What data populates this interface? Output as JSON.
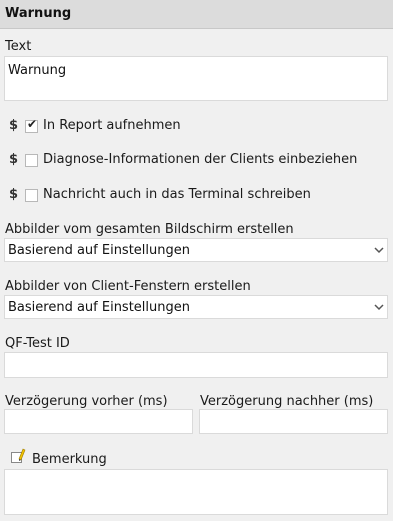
{
  "header": {
    "title": "Warnung"
  },
  "text_section": {
    "label": "Text",
    "value": "Warnung"
  },
  "options": [
    {
      "symbol": "$",
      "label": "In Report aufnehmen",
      "checked": true
    },
    {
      "symbol": "$",
      "label": "Diagnose-Informationen der Clients einbeziehen",
      "checked": false
    },
    {
      "symbol": "$",
      "label": "Nachricht auch in das Terminal schreiben",
      "checked": false
    }
  ],
  "screenshot_full": {
    "label": "Abbilder vom gesamten Bildschirm erstellen",
    "selected": "Basierend auf Einstellungen"
  },
  "screenshot_client": {
    "label": "Abbilder von Client-Fenstern erstellen",
    "selected": "Basierend auf Einstellungen"
  },
  "qftest_id": {
    "label": "QF-Test ID",
    "value": ""
  },
  "delay_before": {
    "label": "Verzögerung vorher (ms)",
    "value": ""
  },
  "delay_after": {
    "label": "Verzögerung nachher (ms)",
    "value": ""
  },
  "comment": {
    "label": "Bemerkung",
    "value": "",
    "icon": "pencil-icon"
  }
}
